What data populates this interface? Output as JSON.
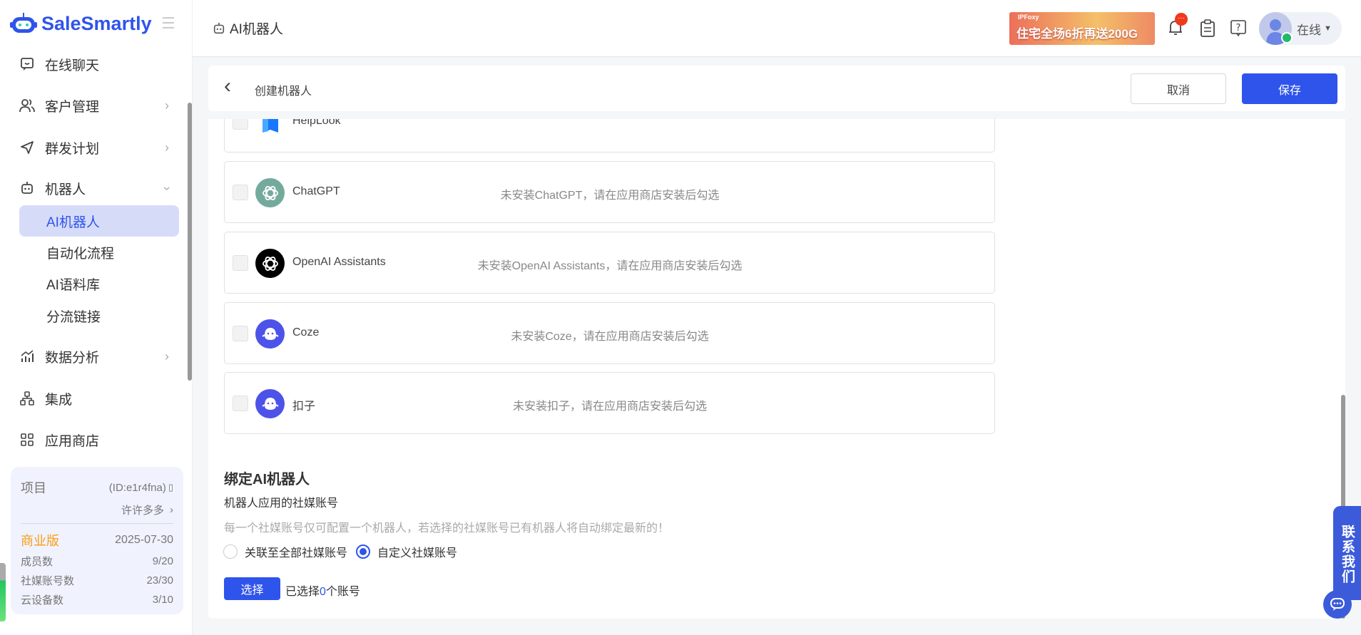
{
  "brand": {
    "name": "SaleSmartly",
    "accent": "#2f54eb"
  },
  "sidebar": {
    "items": [
      {
        "label": "在线聊天",
        "icon": "chat-smile-icon"
      },
      {
        "label": "客户管理",
        "icon": "users-icon"
      },
      {
        "label": "群发计划",
        "icon": "send-icon"
      },
      {
        "label": "机器人",
        "icon": "robot-icon"
      }
    ],
    "sub_items": [
      {
        "label": "AI机器人"
      },
      {
        "label": "自动化流程"
      },
      {
        "label": "AI语料库"
      },
      {
        "label": "分流链接"
      }
    ],
    "items2": [
      {
        "label": "数据分析",
        "icon": "chart-icon"
      },
      {
        "label": "集成",
        "icon": "integration-icon"
      },
      {
        "label": "应用商店",
        "icon": "apps-icon"
      }
    ],
    "project": {
      "label": "项目",
      "id": "(ID:e1r4fna)",
      "name": "许许多多",
      "plan": "商业版",
      "expiry": "2025-07-30",
      "stats": [
        {
          "label": "成员数",
          "value": "9/20"
        },
        {
          "label": "社媒账号数",
          "value": "23/30"
        },
        {
          "label": "云设备数",
          "value": "3/10"
        }
      ]
    }
  },
  "header": {
    "title": "AI机器人",
    "banner": {
      "brand": "IPFoxy",
      "text": "住宅全场6折再送200G"
    },
    "status": "在线",
    "notification_badge": "···"
  },
  "toolbar": {
    "title": "创建机器人",
    "cancel": "取消",
    "save": "保存"
  },
  "integrations": [
    {
      "name": "HelpLook",
      "status": ""
    },
    {
      "name": "ChatGPT",
      "status": "未安装ChatGPT，请在应用商店安装后勾选"
    },
    {
      "name": "OpenAI Assistants",
      "status": "未安装OpenAI Assistants，请在应用商店安装后勾选"
    },
    {
      "name": "Coze",
      "status": "未安装Coze，请在应用商店安装后勾选"
    },
    {
      "name": "扣子",
      "status": "未安装扣子，请在应用商店安装后勾选"
    }
  ],
  "bind": {
    "title": "绑定AI机器人",
    "subtitle": "机器人应用的社媒账号",
    "hint": "每一个社媒账号仅可配置一个机器人，若选择的社媒账号已有机器人将自动绑定最新的！",
    "options": [
      {
        "label": "关联至全部社媒账号",
        "selected": false
      },
      {
        "label": "自定义社媒账号",
        "selected": true
      }
    ],
    "select_button": "选择",
    "selected_prefix": "已选择",
    "selected_count": "0",
    "selected_suffix": "个账号"
  },
  "contact": {
    "label": "联系我们"
  }
}
